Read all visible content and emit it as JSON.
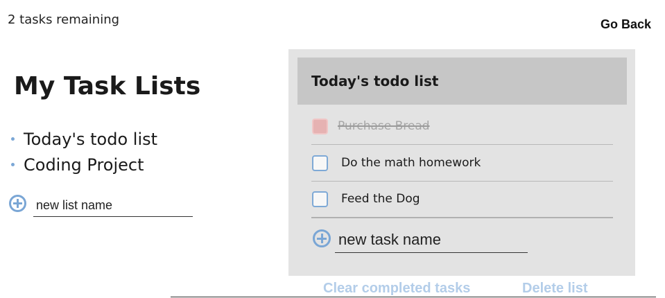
{
  "status": {
    "tasks_remaining": "2 tasks remaining"
  },
  "nav": {
    "go_back": "Go Back"
  },
  "sidebar": {
    "title": "My Task Lists",
    "lists": [
      {
        "label": "Today's todo list"
      },
      {
        "label": "Coding Project"
      }
    ],
    "new_list": {
      "placeholder": "new list name",
      "add_icon": "plus-circle-icon"
    }
  },
  "panel": {
    "title": "Today's todo list",
    "tasks": [
      {
        "label": "Purchase Bread",
        "completed": true
      },
      {
        "label": "Do the math homework",
        "completed": false
      },
      {
        "label": "Feed the Dog",
        "completed": false
      }
    ],
    "new_task": {
      "placeholder": "new task name",
      "add_icon": "plus-circle-icon"
    }
  },
  "actions": {
    "clear_completed": "Clear completed tasks",
    "delete_list": "Delete list"
  },
  "colors": {
    "accent": "#7aa6d5",
    "panel_bg": "#e3e3e3",
    "panel_header_bg": "#c6c6c6",
    "link_color": "#b3cde9",
    "checked_box": "#e6b2b2"
  }
}
